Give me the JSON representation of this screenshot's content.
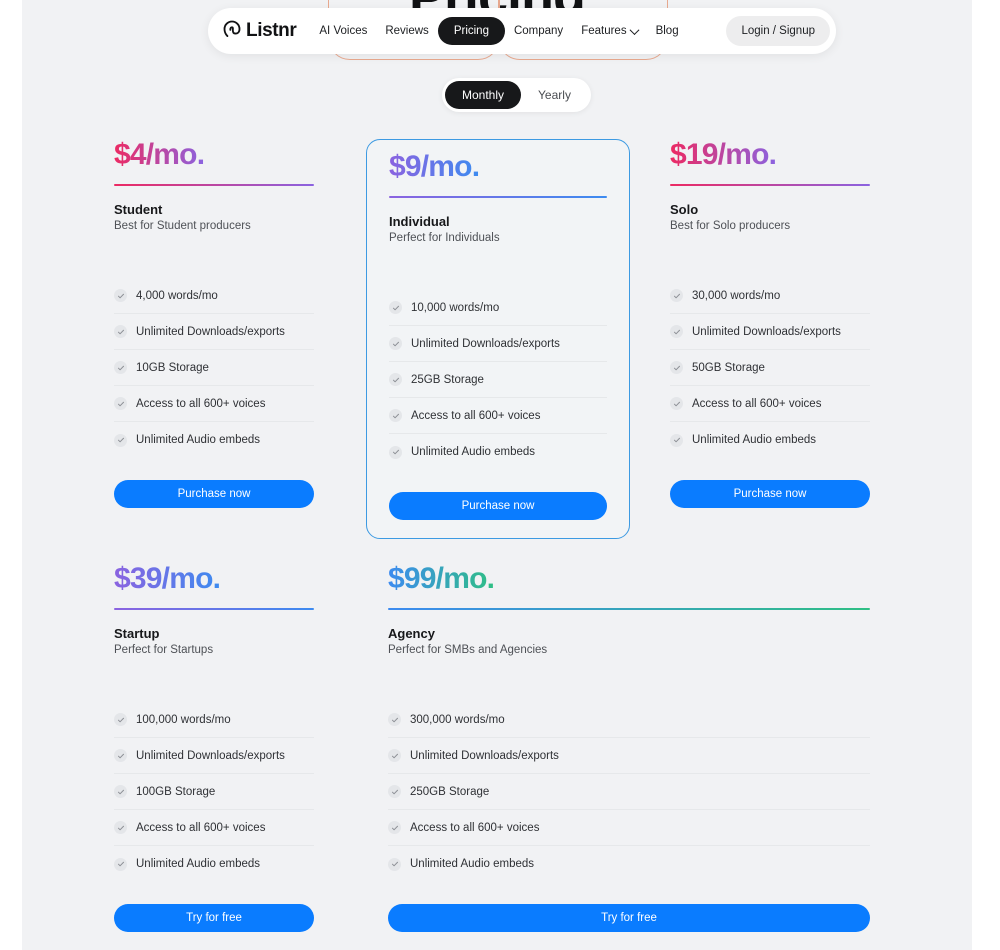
{
  "hero": {
    "heading": "Pricing"
  },
  "nav": {
    "brand": "Listnr",
    "links": [
      {
        "label": "AI Voices",
        "active": false,
        "has_chevron": false
      },
      {
        "label": "Reviews",
        "active": false,
        "has_chevron": false
      },
      {
        "label": "Pricing",
        "active": true,
        "has_chevron": false
      },
      {
        "label": "Company",
        "active": false,
        "has_chevron": false
      },
      {
        "label": "Features",
        "active": false,
        "has_chevron": true
      },
      {
        "label": "Blog",
        "active": false,
        "has_chevron": false
      }
    ],
    "login_label": "Login / Signup"
  },
  "billing_toggle": {
    "options": [
      {
        "label": "Monthly",
        "selected": true
      },
      {
        "label": "Yearly",
        "selected": false
      }
    ]
  },
  "colors": {
    "cta_blue": "#0a7cff",
    "featured_border": "#3d9ae2",
    "pink": "#ec2a63",
    "purple": "#8b63e0",
    "blue": "#3d8bf0",
    "green": "#2fbf84",
    "page_bg": "#f1f2f4"
  },
  "plans": [
    {
      "id": "student",
      "price": "$4/mo.",
      "price_amount": "$4",
      "price_suffix": "/mo.",
      "gradient_from": "#ec2a63",
      "gradient_to": "#8b63e0",
      "name": "Student",
      "desc": "Best for Student producers",
      "features": [
        "4,000 words/mo",
        "Unlimited Downloads/exports",
        "10GB Storage",
        "Access to all 600+ voices",
        "Unlimited Audio embeds"
      ],
      "cta": "Purchase now",
      "featured": false
    },
    {
      "id": "individual",
      "price": "$9/mo.",
      "price_amount": "$9",
      "price_suffix": "/mo.",
      "gradient_from": "#8b63e0",
      "gradient_to": "#3d8bf0",
      "name": "Individual",
      "desc": "Perfect for Individuals",
      "features": [
        "10,000 words/mo",
        "Unlimited Downloads/exports",
        "25GB Storage",
        "Access to all 600+ voices",
        "Unlimited Audio embeds"
      ],
      "cta": "Purchase now",
      "featured": true
    },
    {
      "id": "solo",
      "price": "$19/mo.",
      "price_amount": "$19",
      "price_suffix": "/mo.",
      "gradient_from": "#ec2a63",
      "gradient_to": "#8b63e0",
      "name": "Solo",
      "desc": "Best for Solo producers",
      "features": [
        "30,000 words/mo",
        "Unlimited Downloads/exports",
        "50GB Storage",
        "Access to all 600+ voices",
        "Unlimited Audio embeds"
      ],
      "cta": "Purchase now",
      "featured": false
    },
    {
      "id": "startup",
      "price": "$39/mo.",
      "price_amount": "$39",
      "price_suffix": "/mo.",
      "gradient_from": "#8b63e0",
      "gradient_to": "#3d8bf0",
      "name": "Startup",
      "desc": "Perfect for Startups",
      "features": [
        "100,000 words/mo",
        "Unlimited Downloads/exports",
        "100GB Storage",
        "Access to all 600+ voices",
        "Unlimited Audio embeds"
      ],
      "cta": "Try for free",
      "featured": false
    },
    {
      "id": "agency",
      "price": "$99/mo.",
      "price_amount": "$99",
      "price_suffix": "/mo.",
      "gradient_from": "#3d8bf0",
      "gradient_to": "#2fbf84",
      "name": "Agency",
      "desc": "Perfect for SMBs and Agencies",
      "features": [
        "300,000 words/mo",
        "Unlimited Downloads/exports",
        "250GB Storage",
        "Access to all 600+ voices",
        "Unlimited Audio embeds"
      ],
      "cta": "Try for free",
      "featured": false
    }
  ]
}
